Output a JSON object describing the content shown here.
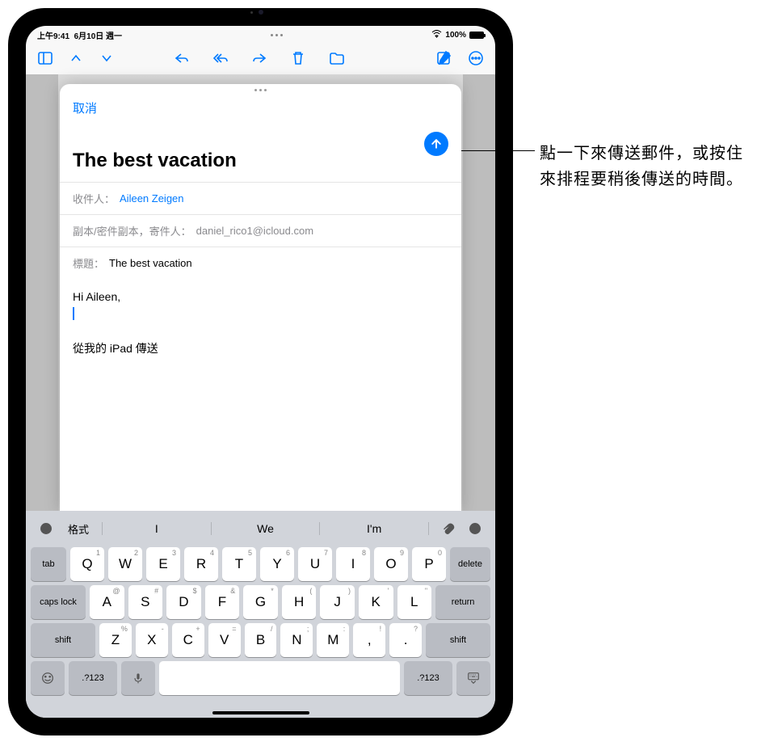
{
  "status": {
    "time": "上午9:41",
    "date": "6月10日 週一",
    "battery": "100%"
  },
  "compose": {
    "cancel": "取消",
    "subject_big": "The best vacation",
    "to_label": "收件人：",
    "to_value": "Aileen Zeigen",
    "cc_label": "副本/密件副本，寄件人：",
    "cc_value": "daniel_rico1@icloud.com",
    "subject_label": "標題：",
    "subject_value": "The best vacation",
    "body_greeting": "Hi Aileen,",
    "signature": "從我的 iPad 傳送"
  },
  "keyboard": {
    "format": "格式",
    "suggestions": [
      "I",
      "We",
      "I'm"
    ],
    "row1_subs": [
      "1",
      "2",
      "3",
      "4",
      "5",
      "6",
      "7",
      "8",
      "9",
      "0"
    ],
    "row1": [
      "Q",
      "W",
      "E",
      "R",
      "T",
      "Y",
      "U",
      "I",
      "O",
      "P"
    ],
    "row2_subs": [
      "@",
      "#",
      "$",
      "&",
      "*",
      "(",
      ")",
      "'",
      "\""
    ],
    "row2": [
      "A",
      "S",
      "D",
      "F",
      "G",
      "H",
      "J",
      "K",
      "L"
    ],
    "row3_subs": [
      "%",
      "-",
      "+",
      "=",
      "/",
      ";",
      ":",
      "!",
      "?"
    ],
    "row3": [
      "Z",
      "X",
      "C",
      "V",
      "B",
      "N",
      "M",
      ",",
      "."
    ],
    "tab": "tab",
    "delete": "delete",
    "caps": "caps lock",
    "ret": "return",
    "shift": "shift",
    "num": ".?123"
  },
  "callout": {
    "text": "點一下來傳送郵件，或按住來排程要稍後傳送的時間。"
  }
}
